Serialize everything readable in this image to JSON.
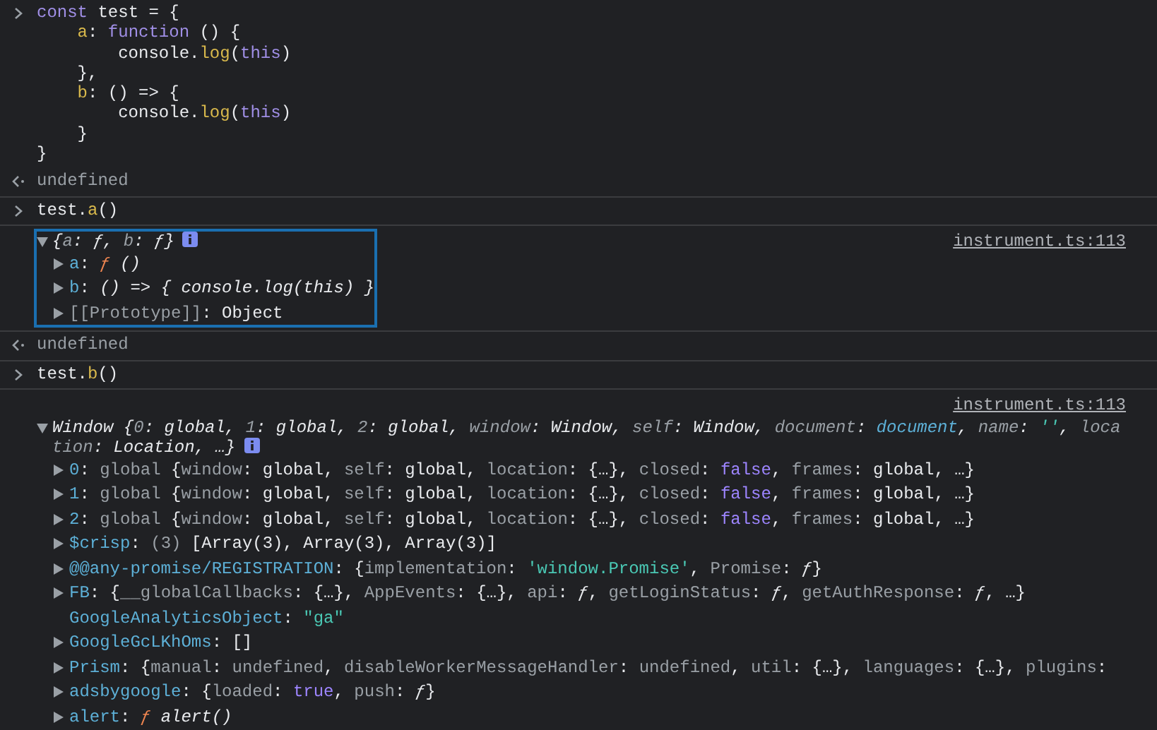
{
  "entries": [
    {
      "kind": "input",
      "lines": [
        [
          {
            "text": "const",
            "kind": "keyword"
          },
          {
            "text": " test = {",
            "kind": "plain"
          }
        ],
        [
          {
            "text": "    a",
            "kind": "prop"
          },
          {
            "text": ": ",
            "kind": "plain"
          },
          {
            "text": "function",
            "kind": "keyword"
          },
          {
            "text": " () {",
            "kind": "plain"
          }
        ],
        [
          {
            "text": "        console.",
            "kind": "plain"
          },
          {
            "text": "log",
            "kind": "method"
          },
          {
            "text": "(",
            "kind": "plain"
          },
          {
            "text": "this",
            "kind": "keyword"
          },
          {
            "text": ")",
            "kind": "plain"
          }
        ],
        [
          {
            "text": "    },",
            "kind": "plain"
          }
        ],
        [
          {
            "text": "    b",
            "kind": "prop"
          },
          {
            "text": ": () => {",
            "kind": "plain"
          }
        ],
        [
          {
            "text": "        console.",
            "kind": "plain"
          },
          {
            "text": "log",
            "kind": "method"
          },
          {
            "text": "(",
            "kind": "plain"
          },
          {
            "text": "this",
            "kind": "keyword"
          },
          {
            "text": ")",
            "kind": "plain"
          }
        ],
        [
          {
            "text": "    }",
            "kind": "plain"
          }
        ],
        [
          {
            "text": "}",
            "kind": "plain"
          }
        ]
      ]
    },
    {
      "kind": "result",
      "value": [
        {
          "text": "undefined",
          "kind": "dim"
        }
      ]
    },
    {
      "kind": "input",
      "lines": [
        [
          {
            "text": "test.",
            "kind": "plain"
          },
          {
            "text": "a",
            "kind": "method"
          },
          {
            "text": "()",
            "kind": "plain"
          }
        ]
      ]
    },
    {
      "kind": "log",
      "source": "instrument.ts:113",
      "focused": true,
      "expanded": true,
      "header": [
        {
          "text": "{",
          "kind": "plain"
        },
        {
          "text": "a",
          "kind": "dim"
        },
        {
          "text": ": ",
          "kind": "plain"
        },
        {
          "text": "ƒ",
          "kind": "fn"
        },
        {
          "text": ", ",
          "kind": "plain"
        },
        {
          "text": "b",
          "kind": "dim"
        },
        {
          "text": ": ",
          "kind": "plain"
        },
        {
          "text": "ƒ",
          "kind": "fn"
        },
        {
          "text": "}",
          "kind": "plain"
        }
      ],
      "children": [
        {
          "expandable": true,
          "tokens": [
            {
              "text": "a",
              "kind": "key"
            },
            {
              "text": ": ",
              "kind": "plain"
            },
            {
              "text": "ƒ",
              "kind": "func"
            },
            {
              "text": " ()",
              "kind": "fnsrc"
            }
          ]
        },
        {
          "expandable": true,
          "tokens": [
            {
              "text": "b",
              "kind": "key"
            },
            {
              "text": ": ",
              "kind": "plain"
            },
            {
              "text": "() => { console.log(this) }",
              "kind": "fnsrc"
            }
          ]
        },
        {
          "expandable": true,
          "tokens": [
            {
              "text": "[[Prototype]]",
              "kind": "dim"
            },
            {
              "text": ": Object",
              "kind": "plain"
            }
          ]
        }
      ]
    },
    {
      "kind": "result",
      "value": [
        {
          "text": "undefined",
          "kind": "dim"
        }
      ]
    },
    {
      "kind": "input",
      "lines": [
        [
          {
            "text": "test.",
            "kind": "plain"
          },
          {
            "text": "b",
            "kind": "method"
          },
          {
            "text": "()",
            "kind": "plain"
          }
        ]
      ]
    },
    {
      "kind": "log",
      "source": "instrument.ts:113",
      "focused": false,
      "expanded": true,
      "header": [
        {
          "text": "Window {",
          "kind": "plain"
        },
        {
          "text": "0",
          "kind": "dim"
        },
        {
          "text": ": global, ",
          "kind": "plain"
        },
        {
          "text": "1",
          "kind": "dim"
        },
        {
          "text": ": global, ",
          "kind": "plain"
        },
        {
          "text": "2",
          "kind": "dim"
        },
        {
          "text": ": global, ",
          "kind": "plain"
        },
        {
          "text": "window",
          "kind": "dim"
        },
        {
          "text": ": Window, ",
          "kind": "plain"
        },
        {
          "text": "self",
          "kind": "dim"
        },
        {
          "text": ": Window, ",
          "kind": "plain"
        },
        {
          "text": "document",
          "kind": "dim"
        },
        {
          "text": ": ",
          "kind": "plain"
        },
        {
          "text": "document",
          "kind": "node"
        },
        {
          "text": ", ",
          "kind": "plain"
        },
        {
          "text": "name",
          "kind": "dim"
        },
        {
          "text": ": ",
          "kind": "plain"
        },
        {
          "text": "''",
          "kind": "string"
        },
        {
          "text": ", ",
          "kind": "plain"
        },
        {
          "text": "loca",
          "kind": "dim"
        }
      ],
      "header_continued": [
        {
          "text": "tion",
          "kind": "dim"
        },
        {
          "text": ": Location, …}",
          "kind": "plain"
        }
      ],
      "children": [
        {
          "expandable": true,
          "tokens": [
            {
              "text": "0",
              "kind": "key"
            },
            {
              "text": ": ",
              "kind": "plain"
            },
            {
              "text": "global",
              "kind": "dim"
            },
            {
              "text": " {",
              "kind": "plain"
            },
            {
              "text": "window",
              "kind": "dim"
            },
            {
              "text": ": global, ",
              "kind": "plain"
            },
            {
              "text": "self",
              "kind": "dim"
            },
            {
              "text": ": global, ",
              "kind": "plain"
            },
            {
              "text": "location",
              "kind": "dim"
            },
            {
              "text": ": {…}, ",
              "kind": "plain"
            },
            {
              "text": "closed",
              "kind": "dim"
            },
            {
              "text": ": ",
              "kind": "plain"
            },
            {
              "text": "false",
              "kind": "bool"
            },
            {
              "text": ", ",
              "kind": "plain"
            },
            {
              "text": "frames",
              "kind": "dim"
            },
            {
              "text": ": global, …}",
              "kind": "plain"
            }
          ]
        },
        {
          "expandable": true,
          "tokens": [
            {
              "text": "1",
              "kind": "key"
            },
            {
              "text": ": ",
              "kind": "plain"
            },
            {
              "text": "global",
              "kind": "dim"
            },
            {
              "text": " {",
              "kind": "plain"
            },
            {
              "text": "window",
              "kind": "dim"
            },
            {
              "text": ": global, ",
              "kind": "plain"
            },
            {
              "text": "self",
              "kind": "dim"
            },
            {
              "text": ": global, ",
              "kind": "plain"
            },
            {
              "text": "location",
              "kind": "dim"
            },
            {
              "text": ": {…}, ",
              "kind": "plain"
            },
            {
              "text": "closed",
              "kind": "dim"
            },
            {
              "text": ": ",
              "kind": "plain"
            },
            {
              "text": "false",
              "kind": "bool"
            },
            {
              "text": ", ",
              "kind": "plain"
            },
            {
              "text": "frames",
              "kind": "dim"
            },
            {
              "text": ": global, …}",
              "kind": "plain"
            }
          ]
        },
        {
          "expandable": true,
          "tokens": [
            {
              "text": "2",
              "kind": "key"
            },
            {
              "text": ": ",
              "kind": "plain"
            },
            {
              "text": "global",
              "kind": "dim"
            },
            {
              "text": " {",
              "kind": "plain"
            },
            {
              "text": "window",
              "kind": "dim"
            },
            {
              "text": ": global, ",
              "kind": "plain"
            },
            {
              "text": "self",
              "kind": "dim"
            },
            {
              "text": ": global, ",
              "kind": "plain"
            },
            {
              "text": "location",
              "kind": "dim"
            },
            {
              "text": ": {…}, ",
              "kind": "plain"
            },
            {
              "text": "closed",
              "kind": "dim"
            },
            {
              "text": ": ",
              "kind": "plain"
            },
            {
              "text": "false",
              "kind": "bool"
            },
            {
              "text": ", ",
              "kind": "plain"
            },
            {
              "text": "frames",
              "kind": "dim"
            },
            {
              "text": ": global, …}",
              "kind": "plain"
            }
          ]
        },
        {
          "expandable": true,
          "tokens": [
            {
              "text": "$crisp",
              "kind": "key"
            },
            {
              "text": ": ",
              "kind": "plain"
            },
            {
              "text": "(3)",
              "kind": "dim"
            },
            {
              "text": " [Array(3), Array(3), Array(3)]",
              "kind": "plain"
            }
          ]
        },
        {
          "expandable": true,
          "tokens": [
            {
              "text": "@@any-promise/REGISTRATION",
              "kind": "key"
            },
            {
              "text": ": {",
              "kind": "plain"
            },
            {
              "text": "implementation",
              "kind": "dim"
            },
            {
              "text": ": ",
              "kind": "plain"
            },
            {
              "text": "'window.Promise'",
              "kind": "string"
            },
            {
              "text": ", ",
              "kind": "plain"
            },
            {
              "text": "Promise",
              "kind": "dim"
            },
            {
              "text": ": ",
              "kind": "plain"
            },
            {
              "text": "ƒ",
              "kind": "fn"
            },
            {
              "text": "}",
              "kind": "plain"
            }
          ]
        },
        {
          "expandable": true,
          "tokens": [
            {
              "text": "FB",
              "kind": "key"
            },
            {
              "text": ": {",
              "kind": "plain"
            },
            {
              "text": "__globalCallbacks",
              "kind": "dim"
            },
            {
              "text": ": {…}, ",
              "kind": "plain"
            },
            {
              "text": "AppEvents",
              "kind": "dim"
            },
            {
              "text": ": {…}, ",
              "kind": "plain"
            },
            {
              "text": "api",
              "kind": "dim"
            },
            {
              "text": ": ",
              "kind": "plain"
            },
            {
              "text": "ƒ",
              "kind": "fn"
            },
            {
              "text": ", ",
              "kind": "plain"
            },
            {
              "text": "getLoginStatus",
              "kind": "dim"
            },
            {
              "text": ": ",
              "kind": "plain"
            },
            {
              "text": "ƒ",
              "kind": "fn"
            },
            {
              "text": ", ",
              "kind": "plain"
            },
            {
              "text": "getAuthResponse",
              "kind": "dim"
            },
            {
              "text": ": ",
              "kind": "plain"
            },
            {
              "text": "ƒ",
              "kind": "fn"
            },
            {
              "text": ", …}",
              "kind": "plain"
            }
          ]
        },
        {
          "expandable": false,
          "tokens": [
            {
              "text": "GoogleAnalyticsObject",
              "kind": "key"
            },
            {
              "text": ": ",
              "kind": "plain"
            },
            {
              "text": "\"ga\"",
              "kind": "string"
            }
          ]
        },
        {
          "expandable": true,
          "tokens": [
            {
              "text": "GoogleGcLKhOms",
              "kind": "key"
            },
            {
              "text": ": []",
              "kind": "plain"
            }
          ]
        },
        {
          "expandable": true,
          "tokens": [
            {
              "text": "Prism",
              "kind": "key"
            },
            {
              "text": ": {",
              "kind": "plain"
            },
            {
              "text": "manual",
              "kind": "dim"
            },
            {
              "text": ": ",
              "kind": "plain"
            },
            {
              "text": "undefined",
              "kind": "dim"
            },
            {
              "text": ", ",
              "kind": "plain"
            },
            {
              "text": "disableWorkerMessageHandler",
              "kind": "dim"
            },
            {
              "text": ": ",
              "kind": "plain"
            },
            {
              "text": "undefined",
              "kind": "dim"
            },
            {
              "text": ", ",
              "kind": "plain"
            },
            {
              "text": "util",
              "kind": "dim"
            },
            {
              "text": ": {…}, ",
              "kind": "plain"
            },
            {
              "text": "languages",
              "kind": "dim"
            },
            {
              "text": ": {…}, ",
              "kind": "plain"
            },
            {
              "text": "plugins",
              "kind": "dim"
            },
            {
              "text": ":",
              "kind": "plain"
            }
          ]
        },
        {
          "expandable": true,
          "tokens": [
            {
              "text": "adsbygoogle",
              "kind": "key"
            },
            {
              "text": ": {",
              "kind": "plain"
            },
            {
              "text": "loaded",
              "kind": "dim"
            },
            {
              "text": ": ",
              "kind": "plain"
            },
            {
              "text": "true",
              "kind": "bool"
            },
            {
              "text": ", ",
              "kind": "plain"
            },
            {
              "text": "push",
              "kind": "dim"
            },
            {
              "text": ": ",
              "kind": "plain"
            },
            {
              "text": "ƒ",
              "kind": "fn"
            },
            {
              "text": "}",
              "kind": "plain"
            }
          ]
        },
        {
          "expandable": true,
          "tokens": [
            {
              "text": "alert",
              "kind": "key"
            },
            {
              "text": ": ",
              "kind": "plain"
            },
            {
              "text": "ƒ",
              "kind": "func"
            },
            {
              "text": " alert()",
              "kind": "fnsrc"
            }
          ]
        }
      ]
    }
  ]
}
